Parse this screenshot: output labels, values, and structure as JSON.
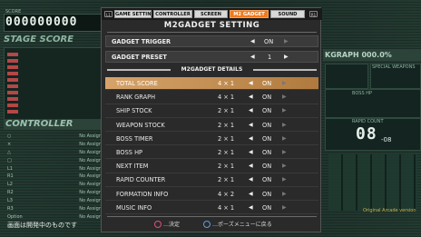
{
  "background": {
    "score_label": "SCORE",
    "score_digits": "000000000",
    "stage_score_label": "STAGE SCORE",
    "controller_label": "CONTROLLER",
    "controller_rows": [
      {
        "button": "○",
        "assign": "No Assign"
      },
      {
        "button": "×",
        "assign": "No Assign"
      },
      {
        "button": "△",
        "assign": "No Assign"
      },
      {
        "button": "□",
        "assign": "No Assign"
      },
      {
        "button": "L1",
        "assign": "No Assign"
      },
      {
        "button": "R1",
        "assign": "No Assign"
      },
      {
        "button": "L2",
        "assign": "No Assign"
      },
      {
        "button": "R2",
        "assign": "No Assign"
      },
      {
        "button": "L3",
        "assign": "No Assign"
      },
      {
        "button": "R3",
        "assign": "No Assign"
      },
      {
        "button": "Option",
        "assign": "No Assign"
      }
    ],
    "rank_graph_label": "KGRAPH 000.0%",
    "special_weapons_label": "SPECIAL WEAPONS",
    "boss_hp_label": "BOSS HP",
    "rapid_count_label": "RAPID COUNT",
    "timer_digits": "08",
    "timer_sub": "-08",
    "arcade_label": "Original Arcade version",
    "caution": "画面は開発中のものです"
  },
  "modal": {
    "shoulder_left": "L1",
    "shoulder_right": "R1",
    "tabs": [
      {
        "label": "GAME SETTING",
        "active": false
      },
      {
        "label": "CONTROLLER",
        "active": false
      },
      {
        "label": "SCREEN",
        "active": false
      },
      {
        "label": "M2 GADGET",
        "active": true
      },
      {
        "label": "SOUND",
        "active": false
      }
    ],
    "title": "M2GADGET SETTING",
    "gadget_trigger": {
      "label": "GADGET TRIGGER",
      "value": "ON"
    },
    "gadget_preset": {
      "label": "GADGET PRESET",
      "value": "1"
    },
    "details_title": "M2GADGET DETAILS",
    "details": [
      {
        "name": "TOTAL SCORE",
        "size": "4 × 1",
        "state": "ON",
        "selected": true
      },
      {
        "name": "RANK GRAPH",
        "size": "4 × 1",
        "state": "ON",
        "selected": false
      },
      {
        "name": "SHIP STOCK",
        "size": "2 × 1",
        "state": "ON",
        "selected": false
      },
      {
        "name": "WEAPON STOCK",
        "size": "2 × 1",
        "state": "ON",
        "selected": false
      },
      {
        "name": "BOSS TIMER",
        "size": "2 × 1",
        "state": "ON",
        "selected": false
      },
      {
        "name": "BOSS HP",
        "size": "2 × 1",
        "state": "ON",
        "selected": false
      },
      {
        "name": "NEXT ITEM",
        "size": "2 × 1",
        "state": "ON",
        "selected": false
      },
      {
        "name": "RAPID COUNTER",
        "size": "2 × 1",
        "state": "ON",
        "selected": false
      },
      {
        "name": "FORMATION INFO",
        "size": "4 × 2",
        "state": "ON",
        "selected": false
      },
      {
        "name": "MUSIC INFO",
        "size": "4 × 1",
        "state": "ON",
        "selected": false
      }
    ],
    "footer": {
      "confirm": "…決定",
      "back": "…ポーズメニューに戻る"
    }
  },
  "colors": {
    "accent_orange": "#f07a1c",
    "selected_row": "#c48f52",
    "circle_button": "#e0507a",
    "cross_button": "#5aa0e0"
  }
}
